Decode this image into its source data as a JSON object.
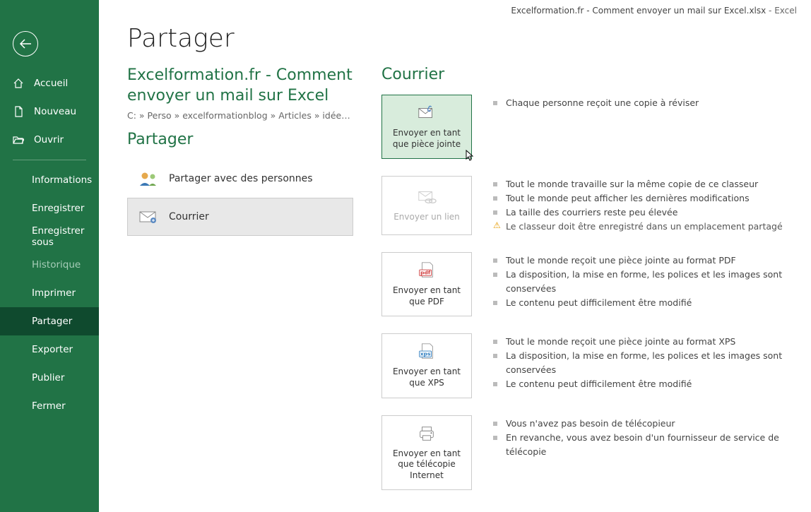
{
  "titlebar": {
    "document": "Excelformation.fr - Comment envoyer un mail sur Excel.xlsx",
    "sep": "  -  ",
    "app": "Excel"
  },
  "nav": {
    "home": "Accueil",
    "new": "Nouveau",
    "open": "Ouvrir",
    "info": "Informations",
    "save": "Enregistrer",
    "saveas": "Enregistrer sous",
    "history": "Historique",
    "print": "Imprimer",
    "share": "Partager",
    "export": "Exporter",
    "publish": "Publier",
    "close": "Fermer"
  },
  "page": {
    "title": "Partager"
  },
  "docinfo": {
    "title": "Excelformation.fr - Comment envoyer un mail sur Excel",
    "path": "C: » Perso » excelformationblog » Articles » idées » Envo...",
    "section": "Partager"
  },
  "share_options": {
    "people": "Partager avec des personnes",
    "mail": "Courrier"
  },
  "courier": {
    "title": "Courrier",
    "options": [
      {
        "label": "Envoyer en tant que pièce jointe",
        "desc": [
          {
            "text": "Chaque personne reçoit une copie à réviser"
          }
        ]
      },
      {
        "label": "Envoyer un lien",
        "desc": [
          {
            "text": "Tout le monde travaille sur la même copie de ce classeur"
          },
          {
            "text": "Tout le monde peut afficher les dernières modifications"
          },
          {
            "text": "La taille des courriers reste peu élevée"
          },
          {
            "text": "Le classeur doit être enregistré dans un emplacement partagé",
            "warn": true
          }
        ]
      },
      {
        "label": "Envoyer en tant que PDF",
        "desc": [
          {
            "text": "Tout le monde reçoit une pièce jointe au format PDF"
          },
          {
            "text": "La disposition, la mise en forme, les polices et les images sont conservées"
          },
          {
            "text": "Le contenu peut difficilement être modifié"
          }
        ]
      },
      {
        "label": "Envoyer en tant que XPS",
        "desc": [
          {
            "text": "Tout le monde reçoit une pièce jointe au format XPS"
          },
          {
            "text": "La disposition, la mise en forme, les polices et les images sont conservées"
          },
          {
            "text": "Le contenu peut difficilement être modifié"
          }
        ]
      },
      {
        "label": "Envoyer en tant que télécopie Internet",
        "desc": [
          {
            "text": "Vous n'avez pas besoin de télécopieur"
          },
          {
            "text": "En revanche, vous avez besoin d'un fournisseur de service de télécopie"
          }
        ]
      }
    ]
  }
}
